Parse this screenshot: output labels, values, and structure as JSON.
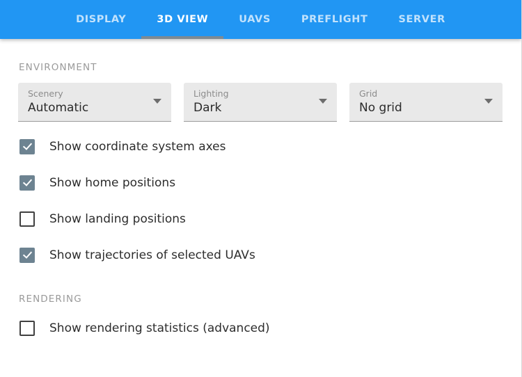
{
  "theme": {
    "accent": "#2196f3",
    "tab_indicator": "#7e8a93",
    "checkbox_checked": "#6d8391",
    "section_header_color": "#9a9a9a",
    "select_fill": "#e9e9e9"
  },
  "tabs": {
    "items": [
      {
        "label": "DISPLAY",
        "active": false
      },
      {
        "label": "3D VIEW",
        "active": true
      },
      {
        "label": "UAVS",
        "active": false
      },
      {
        "label": "PREFLIGHT",
        "active": false
      },
      {
        "label": "SERVER",
        "active": false
      }
    ]
  },
  "environment": {
    "header": "ENVIRONMENT",
    "selects": [
      {
        "label": "Scenery",
        "value": "Automatic",
        "icon": "chevron-down-icon"
      },
      {
        "label": "Lighting",
        "value": "Dark",
        "icon": "chevron-down-icon"
      },
      {
        "label": "Grid",
        "value": "No grid",
        "icon": "chevron-down-icon"
      }
    ],
    "checkboxes": [
      {
        "label": "Show coordinate system axes",
        "checked": true
      },
      {
        "label": "Show home positions",
        "checked": true
      },
      {
        "label": "Show landing positions",
        "checked": false
      },
      {
        "label": "Show trajectories of selected UAVs",
        "checked": true
      }
    ]
  },
  "rendering": {
    "header": "RENDERING",
    "checkboxes": [
      {
        "label": "Show rendering statistics (advanced)",
        "checked": false
      }
    ]
  }
}
